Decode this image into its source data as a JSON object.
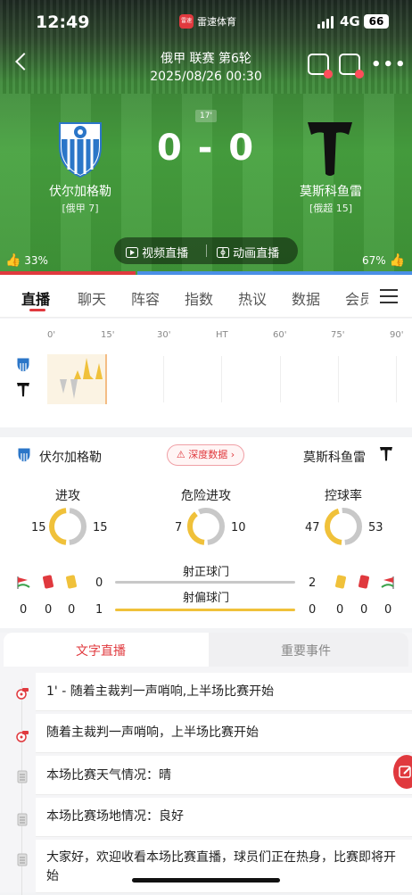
{
  "status_bar": {
    "time": "12:49",
    "app_badge": "雷速",
    "app_name": "雷速体育",
    "network": "4G",
    "battery": "66"
  },
  "header": {
    "league": "俄甲 联赛 第6轮",
    "datetime": "2025/08/26 00:30"
  },
  "match": {
    "minute": "17'",
    "score": "0 - 0",
    "home": {
      "name": "伏尔加格勒",
      "sub": "[俄甲 7]",
      "crest_text": "СК«РОТОР»",
      "support": "33%"
    },
    "away": {
      "name": "莫斯科鱼雷",
      "sub": "[俄超 15]",
      "support": "67%"
    },
    "video_live": "视频直播",
    "anim_live": "动画直播"
  },
  "colors": {
    "brand_red": "#e0393e",
    "home_bar": "#e0393e",
    "away_bar": "#4a8fe6",
    "stat_yellow": "#f0c13a",
    "stat_gray": "#c8c8c8"
  },
  "tabs": [
    "直播",
    "聊天",
    "阵容",
    "指数",
    "热议",
    "数据",
    "会员"
  ],
  "timeline": {
    "labels": [
      "0'",
      "15'",
      "30'",
      "HT",
      "60'",
      "75'",
      "90'"
    ]
  },
  "stats": {
    "home_name": "伏尔加格勒",
    "away_name": "莫斯科鱼雷",
    "deep_data": "深度数据",
    "items": [
      {
        "label": "进攻",
        "home": "15",
        "away": "15"
      },
      {
        "label": "危险进攻",
        "home": "7",
        "away": "10"
      },
      {
        "label": "控球率",
        "home": "47",
        "away": "53"
      }
    ],
    "shots_on_label": "射正球门",
    "shots_off_label": "射偏球门",
    "shots_on": {
      "home": "0",
      "away": "2"
    },
    "shots_off": {
      "home": "1",
      "away": "0"
    },
    "home_counts": [
      "0",
      "0",
      "0"
    ],
    "away_counts": [
      "0",
      "0",
      "0"
    ]
  },
  "commentary": {
    "tab_text": "文字直播",
    "tab_events": "重要事件",
    "items": [
      {
        "icon": "whistle-icon",
        "text": "1' - 随着主裁判一声哨响,上半场比赛开始"
      },
      {
        "icon": "whistle-icon",
        "text": "随着主裁判一声哨响，上半场比赛开始"
      },
      {
        "icon": "notepad-icon",
        "text": "本场比赛天气情况：晴"
      },
      {
        "icon": "notepad-icon",
        "text": "本场比赛场地情况：良好"
      },
      {
        "icon": "notepad-icon",
        "text": "大家好，欢迎收看本场比赛直播，球员们正在热身，比赛即将开始"
      }
    ]
  }
}
